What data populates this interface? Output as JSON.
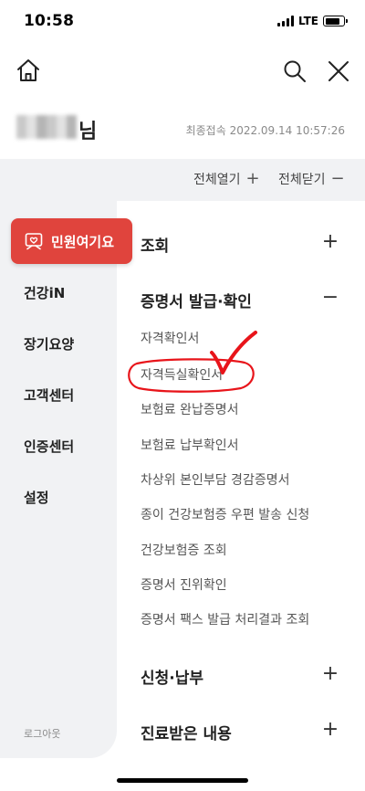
{
  "status_bar": {
    "time": "10:58",
    "network": "LTE"
  },
  "user": {
    "suffix": "님",
    "last_login": "최종접속 2022.09.14 10:57:26"
  },
  "controls": {
    "expand_all": "전체열기",
    "collapse_all": "전체닫기",
    "plus": "+",
    "minus": "−"
  },
  "sidebar": {
    "active": "민원여기요",
    "items": [
      "건강iN",
      "장기요양",
      "고객센터",
      "인증센터",
      "설정"
    ],
    "logout": "로그아웃"
  },
  "sections": [
    {
      "title": "조회",
      "toggle": "+"
    },
    {
      "title": "증명서 발급·확인",
      "toggle": "−",
      "items": [
        "자격확인서",
        "자격득실확인서",
        "보험료 완납증명서",
        "보험료 납부확인서",
        "차상위 본인부담 경감증명서",
        "종이 건강보험증 우편 발송 신청",
        "건강보험증 조회",
        "증명서 진위확인",
        "증명서 팩스 발급 처리결과 조회"
      ]
    },
    {
      "title": "신청·납부",
      "toggle": "+"
    },
    {
      "title": "진료받은 내용",
      "toggle": "+"
    }
  ],
  "colors": {
    "accent": "#e0443d",
    "annotation": "#e8141a",
    "panel_bg": "#f1f2f4"
  },
  "icons": [
    "home-icon",
    "search-icon",
    "close-icon",
    "heart-hand-icon"
  ]
}
